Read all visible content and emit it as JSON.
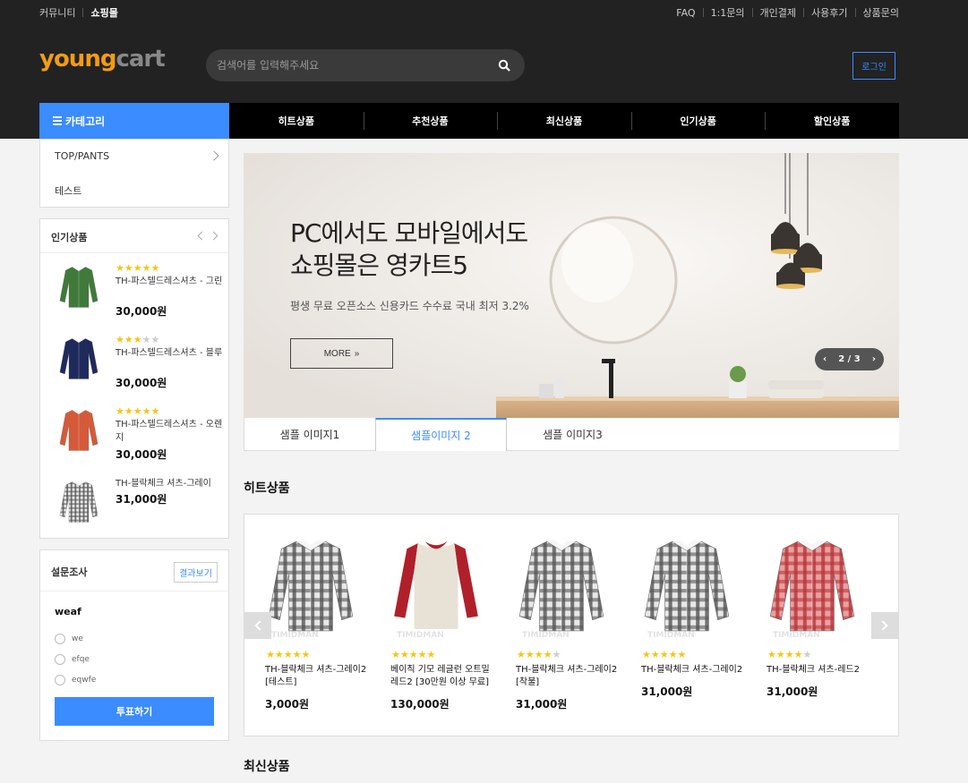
{
  "topbar": {
    "left": [
      "커뮤니티",
      "쇼핑몰"
    ],
    "right": [
      "FAQ",
      "1:1문의",
      "개인결제",
      "사용후기",
      "상품문의"
    ]
  },
  "header": {
    "logo_part1": "young",
    "logo_part2": "cart",
    "search_placeholder": "검색어를 입력해주세요",
    "login": "로그인"
  },
  "nav": {
    "category": "카테고리",
    "menu": [
      "히트상품",
      "추천상품",
      "최신상품",
      "인기상품",
      "할인상품"
    ]
  },
  "categories": [
    "TOP/PANTS",
    "테스트"
  ],
  "popular": {
    "title": "인기상품",
    "items": [
      {
        "rating": 5,
        "name": "TH-파스텔드레스셔츠 - 그린",
        "price": "30,000원",
        "color": "#3f7a3a"
      },
      {
        "rating": 3,
        "name": "TH-파스텔드레스셔츠 - 블루",
        "price": "30,000원",
        "color": "#1e2a5c"
      },
      {
        "rating": 5,
        "name": "TH-파스텔드레스셔츠 - 오렌지",
        "price": "30,000원",
        "color": "#d45a3a"
      },
      {
        "rating": 0,
        "name": "TH-블락체크 셔츠-그레이",
        "price": "31,000원",
        "color": "#8a8a8a"
      }
    ]
  },
  "poll": {
    "title": "설문조사",
    "results": "결과보기",
    "question": "weaf",
    "options": [
      "we",
      "efqe",
      "eqwfe"
    ],
    "vote": "투표하기"
  },
  "banner": {
    "headline1": "PC에서도 모바일에서도",
    "headline2": "쇼핑몰은 영카트5",
    "subtitle": "평생 무료 오픈소스 신용카드 수수료 국내 최저 3.2%",
    "more": "MORE",
    "pager": "2 / 3",
    "tabs": [
      "샘플 이미지1",
      "샘플이미지 2",
      "샘플 이미지3"
    ],
    "active_tab": 1
  },
  "hit": {
    "title": "히트상품",
    "watermark": "TIMIDMAN",
    "products": [
      {
        "rating": 5,
        "name": "TH-블락체크 셔츠-그레이2 [테스트]",
        "price": "3,000원",
        "kind": "plaid-gray"
      },
      {
        "rating": 5,
        "name": "베이직 기모 레글런 오트밀 레드2 [30만원 이상 무료]",
        "price": "130,000원",
        "kind": "raglan"
      },
      {
        "rating": 4,
        "name": "TH-블락체크 셔츠-그레이2 [착불]",
        "price": "31,000원",
        "kind": "plaid-gray"
      },
      {
        "rating": 5,
        "name": "TH-블락체크 셔츠-그레이2",
        "price": "31,000원",
        "kind": "plaid-gray"
      },
      {
        "rating": 4,
        "name": "TH-블락체크 셔츠-레드2",
        "price": "31,000원",
        "kind": "plaid-red"
      }
    ]
  },
  "latest": {
    "title": "최신상품"
  }
}
